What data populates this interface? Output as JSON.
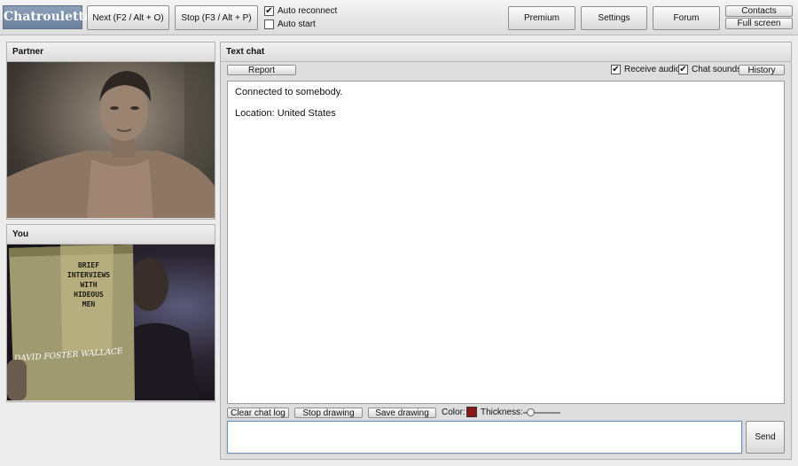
{
  "header": {
    "logo": "Chatroulette",
    "next_label": "Next (F2 / Alt + O)",
    "stop_label": "Stop (F3 / Alt + P)",
    "auto_reconnect": {
      "label": "Auto reconnect",
      "checked": true
    },
    "auto_start": {
      "label": "Auto start",
      "checked": false
    },
    "premium_label": "Premium",
    "settings_label": "Settings",
    "forum_label": "Forum",
    "contacts_label": "Contacts",
    "fullscreen_label": "Full screen"
  },
  "partner": {
    "title": "Partner"
  },
  "you": {
    "title": "You",
    "book": {
      "title_lines": [
        "BRIEF",
        "INTERVIEWS",
        "WITH",
        "HIDEOUS",
        "MEN"
      ],
      "author": "DAVID FOSTER WALLACE"
    }
  },
  "chat": {
    "title": "Text chat",
    "report_label": "Report",
    "receive_audio": {
      "label": "Receive audio",
      "checked": true
    },
    "chat_sounds": {
      "label": "Chat sounds",
      "checked": true
    },
    "history_label": "History",
    "messages": [
      "Connected to somebody.",
      "Location: United States"
    ],
    "clear_label": "Clear chat log",
    "stop_drawing_label": "Stop drawing",
    "save_drawing_label": "Save drawing",
    "color_label": "Color:",
    "thickness_label": "Thickness:",
    "draw_color": "#8a1a1a",
    "thickness_level": 0.1,
    "input_value": "",
    "send_label": "Send"
  }
}
